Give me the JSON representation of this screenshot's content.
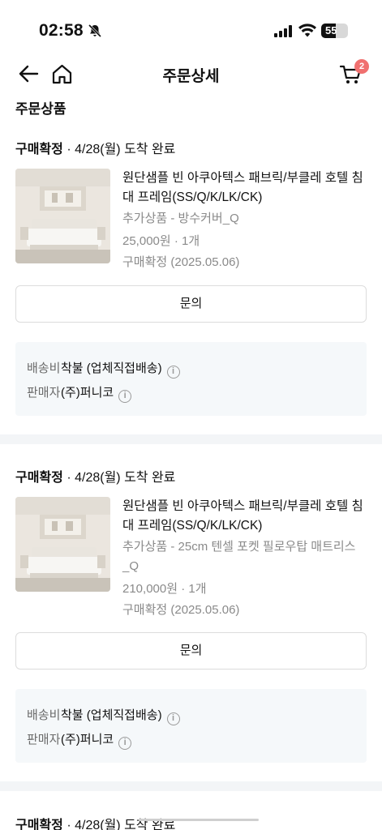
{
  "status_bar": {
    "time": "02:58",
    "battery": "55"
  },
  "header": {
    "title": "주문상세",
    "cart_count": "2"
  },
  "section_title": "주문상품",
  "orders": [
    {
      "status": "구매확정",
      "delivery": " · 4/28(월) 도착 완료",
      "product_name": "원단샘플 빈 아쿠아텍스 패브릭/부클레 호텔 침대 프레임(SS/Q/K/LK/CK)",
      "option": "추가상품 - 방수커버_Q",
      "price": "25,000원 · 1개",
      "confirm_date": "구매확정 (2025.05.06)",
      "inquiry_label": "문의",
      "shipping_label": "배송비",
      "shipping_value": "착불 (업체직접배송)",
      "seller_label": "판매자",
      "seller_value": "(주)퍼니코"
    },
    {
      "status": "구매확정",
      "delivery": " · 4/28(월) 도착 완료",
      "product_name": "원단샘플 빈 아쿠아텍스 패브릭/부클레 호텔 침대 프레임(SS/Q/K/LK/CK)",
      "option": "추가상품 - 25cm 텐셀 포켓 필로우탑 매트리스 _Q",
      "price": "210,000원 · 1개",
      "confirm_date": "구매확정 (2025.05.06)",
      "inquiry_label": "문의",
      "shipping_label": "배송비",
      "shipping_value": "착불 (업체직접배송)",
      "seller_label": "판매자",
      "seller_value": "(주)퍼니코"
    },
    {
      "status": "구매확정",
      "delivery": " · 4/28(월) 도착 완료"
    }
  ],
  "icons": {
    "back": "arrow-left-icon",
    "home": "home-icon",
    "cart": "cart-icon",
    "info": "info-icon"
  },
  "colors": {
    "badge": "#f0706f",
    "info_box": "#f5f8fa",
    "muted_text": "#8a8a8a"
  }
}
